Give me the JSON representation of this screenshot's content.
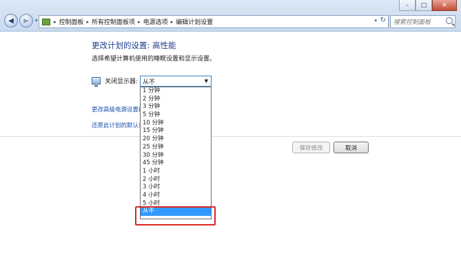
{
  "window": {
    "min": "–",
    "max": "□",
    "close": "✕"
  },
  "nav": {
    "back": "◀",
    "forward": "▶",
    "dropdown": "▾"
  },
  "address": {
    "crumbs": [
      "控制面板",
      "所有控制面板项",
      "电源选项",
      "编辑计划设置"
    ],
    "separator": "▸",
    "dropdown": "▾",
    "refresh": "↻"
  },
  "search": {
    "placeholder": "搜索控制面板"
  },
  "content": {
    "title": "更改计划的设置: 高性能",
    "subtitle": "选择希望计算机使用的睡眠设置和显示设置。",
    "display_label": "关闭显示器:",
    "display_value": "从不",
    "link_advanced": "更改高级电源设置(C",
    "link_restore": "还原此计划的默认设"
  },
  "dropdown": {
    "options": [
      "1 分钟",
      "2 分钟",
      "3 分钟",
      "5 分钟",
      "10 分钟",
      "15 分钟",
      "20 分钟",
      "25 分钟",
      "30 分钟",
      "45 分钟",
      "1 小时",
      "2 小时",
      "3 小时",
      "4 小时",
      "5 小时",
      "从不"
    ],
    "selected": "从不",
    "selected_index": 15
  },
  "buttons": {
    "save": "保存修改",
    "cancel": "取消"
  },
  "colors": {
    "highlight_box": "#d8271e",
    "selection": "#3399ff",
    "title": "#1e3c8c",
    "link": "#1d4fa8"
  }
}
